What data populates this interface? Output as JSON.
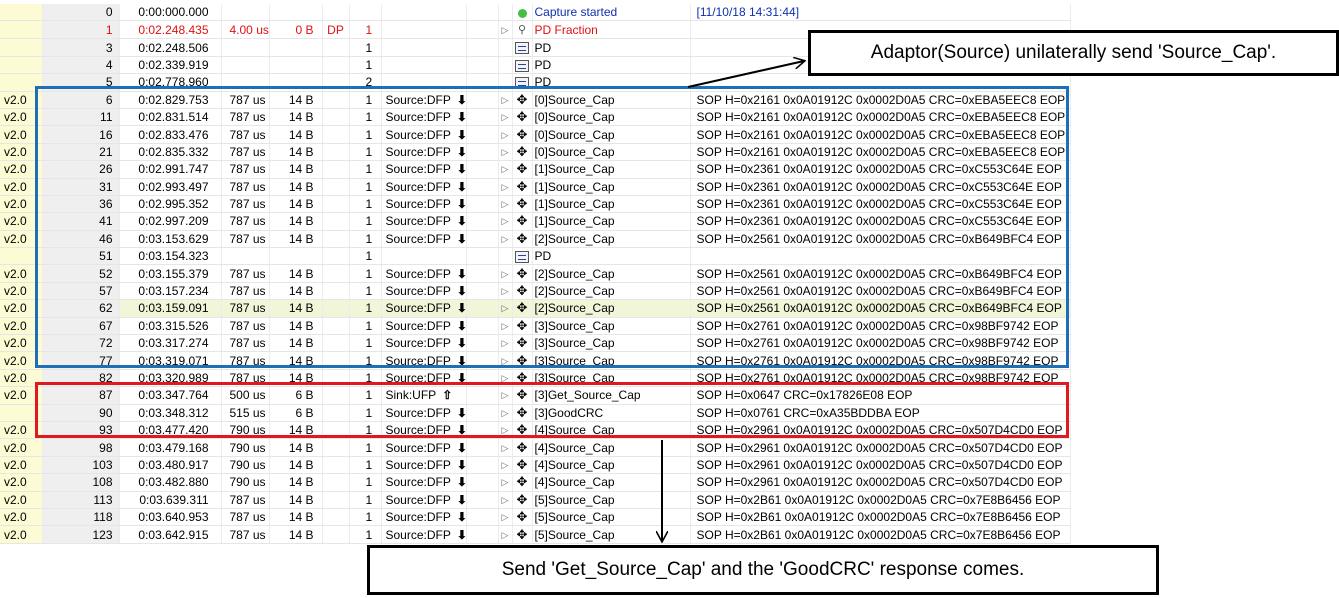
{
  "rows": [
    {
      "ver": "",
      "idx": "0",
      "time": "0:00:000.000",
      "dur": "",
      "size": "",
      "dp": "",
      "cnt": "",
      "role": "",
      "dir": "",
      "tree": "",
      "icon": "capture",
      "event": "Capture started",
      "data": "[11/10/18 14:31:44]",
      "style": "blue"
    },
    {
      "ver": "",
      "idx": "1",
      "time": "0:02.248.435",
      "dur": "4.00 us",
      "size": "0 B",
      "dp": "DP",
      "cnt": "1",
      "role": "",
      "dir": "",
      "tree": "▷",
      "icon": "fraction",
      "event": "PD Fraction",
      "data": "",
      "style": "red"
    },
    {
      "ver": "",
      "idx": "3",
      "time": "0:02.248.506",
      "dur": "",
      "size": "",
      "dp": "",
      "cnt": "1",
      "role": "",
      "dir": "",
      "tree": "",
      "icon": "pd",
      "event": "PD",
      "data": "",
      "style": ""
    },
    {
      "ver": "",
      "idx": "4",
      "time": "0:02.339.919",
      "dur": "",
      "size": "",
      "dp": "",
      "cnt": "1",
      "role": "",
      "dir": "",
      "tree": "",
      "icon": "pd",
      "event": "PD",
      "data": "",
      "style": ""
    },
    {
      "ver": "",
      "idx": "5",
      "time": "0:02.778.960",
      "dur": "",
      "size": "",
      "dp": "",
      "cnt": "2",
      "role": "",
      "dir": "",
      "tree": "",
      "icon": "pd",
      "event": "PD",
      "data": "",
      "style": ""
    },
    {
      "ver": "v2.0",
      "idx": "6",
      "time": "0:02.829.753",
      "dur": "787 us",
      "size": "14 B",
      "dp": "",
      "cnt": "1",
      "role": "Source:DFP",
      "dir": "down",
      "tree": "▷",
      "icon": "usb",
      "event": "[0]Source_Cap",
      "data": "SOP H=0x2161 0x0A01912C 0x0002D0A5 CRC=0xEBA5EEC8 EOP",
      "style": ""
    },
    {
      "ver": "v2.0",
      "idx": "11",
      "time": "0:02.831.514",
      "dur": "787 us",
      "size": "14 B",
      "dp": "",
      "cnt": "1",
      "role": "Source:DFP",
      "dir": "down",
      "tree": "▷",
      "icon": "usb",
      "event": "[0]Source_Cap",
      "data": "SOP H=0x2161 0x0A01912C 0x0002D0A5 CRC=0xEBA5EEC8 EOP",
      "style": ""
    },
    {
      "ver": "v2.0",
      "idx": "16",
      "time": "0:02.833.476",
      "dur": "787 us",
      "size": "14 B",
      "dp": "",
      "cnt": "1",
      "role": "Source:DFP",
      "dir": "down",
      "tree": "▷",
      "icon": "usb",
      "event": "[0]Source_Cap",
      "data": "SOP H=0x2161 0x0A01912C 0x0002D0A5 CRC=0xEBA5EEC8 EOP",
      "style": ""
    },
    {
      "ver": "v2.0",
      "idx": "21",
      "time": "0:02.835.332",
      "dur": "787 us",
      "size": "14 B",
      "dp": "",
      "cnt": "1",
      "role": "Source:DFP",
      "dir": "down",
      "tree": "▷",
      "icon": "usb",
      "event": "[0]Source_Cap",
      "data": "SOP H=0x2161 0x0A01912C 0x0002D0A5 CRC=0xEBA5EEC8 EOP",
      "style": ""
    },
    {
      "ver": "v2.0",
      "idx": "26",
      "time": "0:02.991.747",
      "dur": "787 us",
      "size": "14 B",
      "dp": "",
      "cnt": "1",
      "role": "Source:DFP",
      "dir": "down",
      "tree": "▷",
      "icon": "usb",
      "event": "[1]Source_Cap",
      "data": "SOP H=0x2361 0x0A01912C 0x0002D0A5 CRC=0xC553C64E EOP",
      "style": ""
    },
    {
      "ver": "v2.0",
      "idx": "31",
      "time": "0:02.993.497",
      "dur": "787 us",
      "size": "14 B",
      "dp": "",
      "cnt": "1",
      "role": "Source:DFP",
      "dir": "down",
      "tree": "▷",
      "icon": "usb",
      "event": "[1]Source_Cap",
      "data": "SOP H=0x2361 0x0A01912C 0x0002D0A5 CRC=0xC553C64E EOP",
      "style": ""
    },
    {
      "ver": "v2.0",
      "idx": "36",
      "time": "0:02.995.352",
      "dur": "787 us",
      "size": "14 B",
      "dp": "",
      "cnt": "1",
      "role": "Source:DFP",
      "dir": "down",
      "tree": "▷",
      "icon": "usb",
      "event": "[1]Source_Cap",
      "data": "SOP H=0x2361 0x0A01912C 0x0002D0A5 CRC=0xC553C64E EOP",
      "style": ""
    },
    {
      "ver": "v2.0",
      "idx": "41",
      "time": "0:02.997.209",
      "dur": "787 us",
      "size": "14 B",
      "dp": "",
      "cnt": "1",
      "role": "Source:DFP",
      "dir": "down",
      "tree": "▷",
      "icon": "usb",
      "event": "[1]Source_Cap",
      "data": "SOP H=0x2361 0x0A01912C 0x0002D0A5 CRC=0xC553C64E EOP",
      "style": ""
    },
    {
      "ver": "v2.0",
      "idx": "46",
      "time": "0:03.153.629",
      "dur": "787 us",
      "size": "14 B",
      "dp": "",
      "cnt": "1",
      "role": "Source:DFP",
      "dir": "down",
      "tree": "▷",
      "icon": "usb",
      "event": "[2]Source_Cap",
      "data": "SOP H=0x2561 0x0A01912C 0x0002D0A5 CRC=0xB649BFC4 EOP",
      "style": ""
    },
    {
      "ver": "",
      "idx": "51",
      "time": "0:03.154.323",
      "dur": "",
      "size": "",
      "dp": "",
      "cnt": "1",
      "role": "",
      "dir": "",
      "tree": "",
      "icon": "pd",
      "event": "PD",
      "data": "",
      "style": ""
    },
    {
      "ver": "v2.0",
      "idx": "52",
      "time": "0:03.155.379",
      "dur": "787 us",
      "size": "14 B",
      "dp": "",
      "cnt": "1",
      "role": "Source:DFP",
      "dir": "down",
      "tree": "▷",
      "icon": "usb",
      "event": "[2]Source_Cap",
      "data": "SOP H=0x2561 0x0A01912C 0x0002D0A5 CRC=0xB649BFC4 EOP",
      "style": ""
    },
    {
      "ver": "v2.0",
      "idx": "57",
      "time": "0:03.157.234",
      "dur": "787 us",
      "size": "14 B",
      "dp": "",
      "cnt": "1",
      "role": "Source:DFP",
      "dir": "down",
      "tree": "▷",
      "icon": "usb",
      "event": "[2]Source_Cap",
      "data": "SOP H=0x2561 0x0A01912C 0x0002D0A5 CRC=0xB649BFC4 EOP",
      "style": ""
    },
    {
      "ver": "v2.0",
      "idx": "62",
      "time": "0:03.159.091",
      "dur": "787 us",
      "size": "14 B",
      "dp": "",
      "cnt": "1",
      "role": "Source:DFP",
      "dir": "down",
      "tree": "▷",
      "icon": "usb",
      "event": "[2]Source_Cap",
      "data": "SOP H=0x2561 0x0A01912C 0x0002D0A5 CRC=0xB649BFC4 EOP",
      "style": "hl"
    },
    {
      "ver": "v2.0",
      "idx": "67",
      "time": "0:03.315.526",
      "dur": "787 us",
      "size": "14 B",
      "dp": "",
      "cnt": "1",
      "role": "Source:DFP",
      "dir": "down",
      "tree": "▷",
      "icon": "usb",
      "event": "[3]Source_Cap",
      "data": "SOP H=0x2761 0x0A01912C 0x0002D0A5 CRC=0x98BF9742 EOP",
      "style": ""
    },
    {
      "ver": "v2.0",
      "idx": "72",
      "time": "0:03.317.274",
      "dur": "787 us",
      "size": "14 B",
      "dp": "",
      "cnt": "1",
      "role": "Source:DFP",
      "dir": "down",
      "tree": "▷",
      "icon": "usb",
      "event": "[3]Source_Cap",
      "data": "SOP H=0x2761 0x0A01912C 0x0002D0A5 CRC=0x98BF9742 EOP",
      "style": ""
    },
    {
      "ver": "v2.0",
      "idx": "77",
      "time": "0:03.319.071",
      "dur": "787 us",
      "size": "14 B",
      "dp": "",
      "cnt": "1",
      "role": "Source:DFP",
      "dir": "down",
      "tree": "▷",
      "icon": "usb",
      "event": "[3]Source_Cap",
      "data": "SOP H=0x2761 0x0A01912C 0x0002D0A5 CRC=0x98BF9742 EOP",
      "style": ""
    },
    {
      "ver": "v2.0",
      "idx": "82",
      "time": "0:03.320.989",
      "dur": "787 us",
      "size": "14 B",
      "dp": "",
      "cnt": "1",
      "role": "Source:DFP",
      "dir": "down",
      "tree": "▷",
      "icon": "usb",
      "event": "[3]Source_Cap",
      "data": "SOP H=0x2761 0x0A01912C 0x0002D0A5 CRC=0x98BF9742 EOP",
      "style": ""
    },
    {
      "ver": "v2.0",
      "idx": "87",
      "time": "0:03.347.764",
      "dur": "500 us",
      "size": "6 B",
      "dp": "",
      "cnt": "1",
      "role": "Sink:UFP",
      "dir": "up",
      "tree": "▷",
      "icon": "usb",
      "event": "[3]Get_Source_Cap",
      "data": "SOP H=0x0647 CRC=0x17826E08 EOP",
      "style": ""
    },
    {
      "ver": "",
      "idx": "90",
      "time": "0:03.348.312",
      "dur": "515 us",
      "size": "6 B",
      "dp": "",
      "cnt": "1",
      "role": "Source:DFP",
      "dir": "down",
      "tree": "▷",
      "icon": "usb",
      "event": "[3]GoodCRC",
      "data": "SOP H=0x0761 CRC=0xA35BDDBA EOP",
      "style": ""
    },
    {
      "ver": "v2.0",
      "idx": "93",
      "time": "0:03.477.420",
      "dur": "790 us",
      "size": "14 B",
      "dp": "",
      "cnt": "1",
      "role": "Source:DFP",
      "dir": "down",
      "tree": "▷",
      "icon": "usb",
      "event": "[4]Source_Cap",
      "data": "SOP H=0x2961 0x0A01912C 0x0002D0A5 CRC=0x507D4CD0 EOP",
      "style": ""
    },
    {
      "ver": "v2.0",
      "idx": "98",
      "time": "0:03.479.168",
      "dur": "790 us",
      "size": "14 B",
      "dp": "",
      "cnt": "1",
      "role": "Source:DFP",
      "dir": "down",
      "tree": "▷",
      "icon": "usb",
      "event": "[4]Source_Cap",
      "data": "SOP H=0x2961 0x0A01912C 0x0002D0A5 CRC=0x507D4CD0 EOP",
      "style": ""
    },
    {
      "ver": "v2.0",
      "idx": "103",
      "time": "0:03.480.917",
      "dur": "790 us",
      "size": "14 B",
      "dp": "",
      "cnt": "1",
      "role": "Source:DFP",
      "dir": "down",
      "tree": "▷",
      "icon": "usb",
      "event": "[4]Source_Cap",
      "data": "SOP H=0x2961 0x0A01912C 0x0002D0A5 CRC=0x507D4CD0 EOP",
      "style": ""
    },
    {
      "ver": "v2.0",
      "idx": "108",
      "time": "0:03.482.880",
      "dur": "790 us",
      "size": "14 B",
      "dp": "",
      "cnt": "1",
      "role": "Source:DFP",
      "dir": "down",
      "tree": "▷",
      "icon": "usb",
      "event": "[4]Source_Cap",
      "data": "SOP H=0x2961 0x0A01912C 0x0002D0A5 CRC=0x507D4CD0 EOP",
      "style": ""
    },
    {
      "ver": "v2.0",
      "idx": "113",
      "time": "0:03.639.311",
      "dur": "787 us",
      "size": "14 B",
      "dp": "",
      "cnt": "1",
      "role": "Source:DFP",
      "dir": "down",
      "tree": "▷",
      "icon": "usb",
      "event": "[5]Source_Cap",
      "data": "SOP H=0x2B61 0x0A01912C 0x0002D0A5 CRC=0x7E8B6456 EOP",
      "style": ""
    },
    {
      "ver": "v2.0",
      "idx": "118",
      "time": "0:03.640.953",
      "dur": "787 us",
      "size": "14 B",
      "dp": "",
      "cnt": "1",
      "role": "Source:DFP",
      "dir": "down",
      "tree": "▷",
      "icon": "usb",
      "event": "[5]Source_Cap",
      "data": "SOP H=0x2B61 0x0A01912C 0x0002D0A5 CRC=0x7E8B6456 EOP",
      "style": ""
    },
    {
      "ver": "v2.0",
      "idx": "123",
      "time": "0:03.642.915",
      "dur": "787 us",
      "size": "14 B",
      "dp": "",
      "cnt": "1",
      "role": "Source:DFP",
      "dir": "down",
      "tree": "▷",
      "icon": "usb",
      "event": "[5]Source_Cap",
      "data": "SOP H=0x2B61 0x0A01912C 0x0002D0A5 CRC=0x7E8B6456 EOP",
      "style": ""
    }
  ],
  "annotations": {
    "top": "Adaptor(Source) unilaterally send 'Source_Cap'.",
    "bottom": "Send 'Get_Source_Cap' and the 'GoodCRC' response comes."
  },
  "colors": {
    "blue_box": "#1e6fb8",
    "red_box": "#e0181f",
    "version_bg": "#fdfbd3",
    "index_bg": "#efefef",
    "error_text": "#e11111",
    "info_text": "#1030b0"
  },
  "icons": {
    "capture": "green-dot-icon",
    "fraction": "pd-fraction-icon",
    "pd": "pd-packet-icon",
    "usb": "usb-trident-icon",
    "down": "arrow-down-icon",
    "up": "arrow-up-outline-icon",
    "tree": "expand-triangle-icon"
  }
}
